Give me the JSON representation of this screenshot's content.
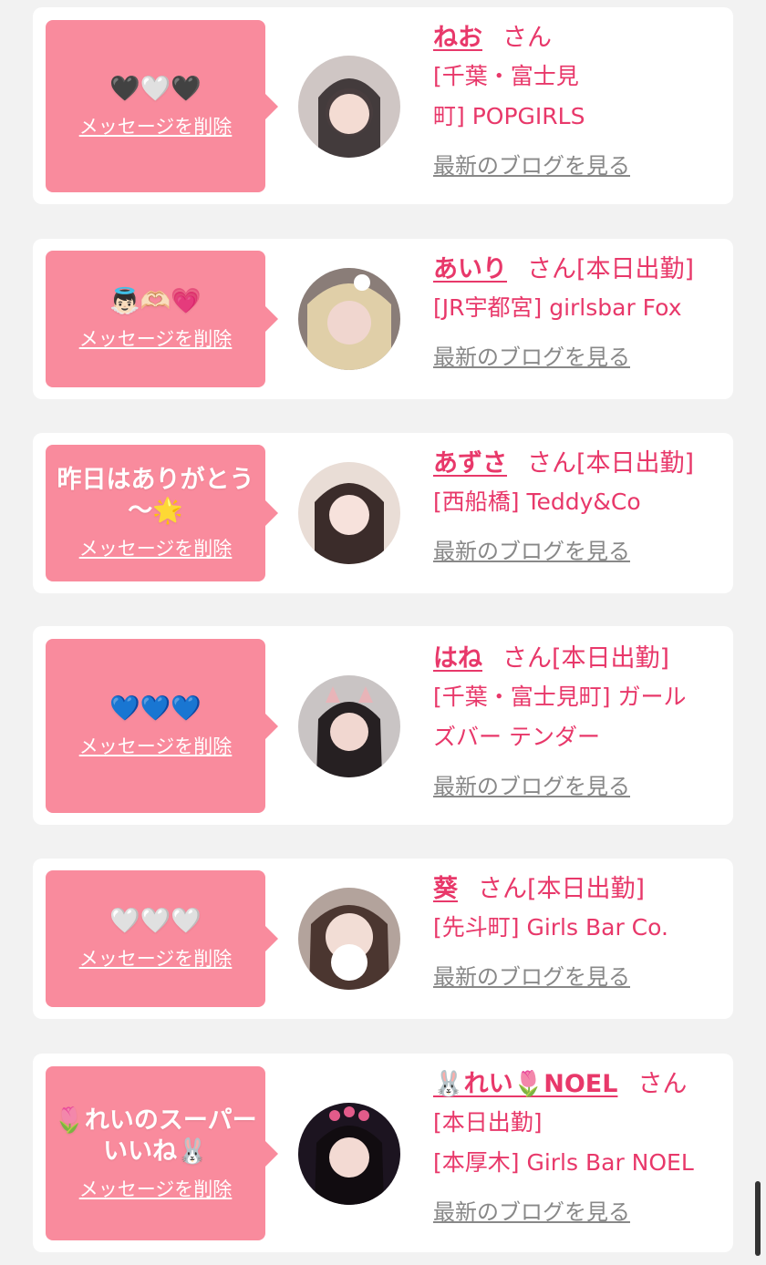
{
  "delete_label": "メッセージを削除",
  "blog_label": "最新のブログを見る",
  "san_label": "さん",
  "colors": {
    "bubble": "#f98b9d",
    "accent": "#e8386a",
    "blog_link": "#888888",
    "background": "#f2f2f2"
  },
  "cards": [
    {
      "message": "🖤🤍🖤",
      "name": "ねお",
      "status": "",
      "shop_lines": [
        "[千葉・富士見",
        "町] POPGIRLS"
      ]
    },
    {
      "message": "👼🏻🫶🏻💗",
      "name": "あいり",
      "status": "[本日出勤]",
      "shop_lines": [
        "[JR宇都宮] girlsbar Fox"
      ]
    },
    {
      "message": "昨日はありがとう\n〜🌟",
      "name": "あずさ",
      "status": "[本日出勤]",
      "shop_lines": [
        "[西船橋] Teddy&Co"
      ]
    },
    {
      "message": "💙💙💙",
      "name": "はね",
      "status": "[本日出勤]",
      "shop_lines": [
        "[千葉・富士見町] ガール",
        "ズバー テンダー"
      ]
    },
    {
      "message": "🤍🤍🤍",
      "name": "葵",
      "status": "[本日出勤]",
      "shop_lines": [
        "[先斗町] Girls Bar Co."
      ]
    },
    {
      "message": "🌷れいのスーパー\nいいね🐰",
      "name": "🐰れい🌷NOEL",
      "status": "",
      "shop_lines": [
        "[本日出勤]",
        "[本厚木] Girls Bar NOEL"
      ]
    }
  ]
}
